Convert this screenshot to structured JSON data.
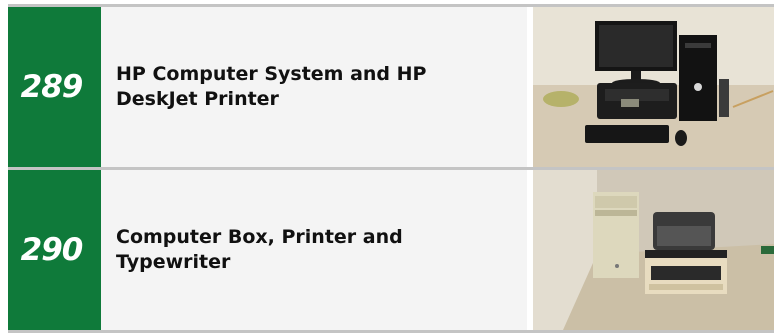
{
  "colors": {
    "lot_green": "#0f7a3a",
    "desc_bg": "#f4f4f4",
    "divider": "#c4c4c4"
  },
  "lots": [
    {
      "number": "289",
      "title": "HP Computer System and HP DeskJet Printer",
      "photo_icon": "computer-printer-photo"
    },
    {
      "number": "290",
      "title": "Computer Box, Printer and Typewriter",
      "photo_icon": "computer-typewriter-photo"
    }
  ]
}
